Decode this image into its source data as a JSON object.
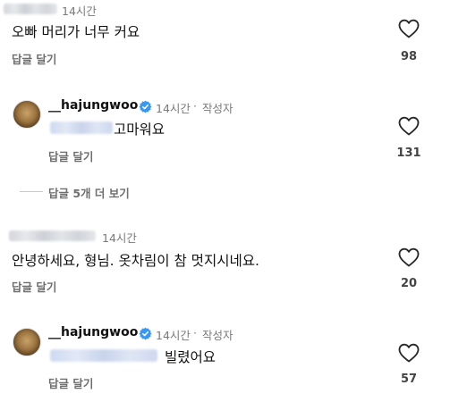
{
  "comments": [
    {
      "id": "c1",
      "time": "14시간",
      "text": "오빠 머리가 너무 커요",
      "reply_label": "답글 달기",
      "likes": "98"
    },
    {
      "id": "r1",
      "username": "__hajungwoo",
      "time": "14시간",
      "separator": "·",
      "author_tag": "작성자",
      "text": "고마워요",
      "reply_label": "답글 달기",
      "likes": "131"
    },
    {
      "id": "c2",
      "time": "14시간",
      "text": "안녕하세요, 형님. 옷차림이 참 멋지시네요.",
      "reply_label": "답글 달기",
      "likes": "20"
    },
    {
      "id": "r2",
      "username": "__hajungwoo",
      "time": "14시간",
      "separator": "·",
      "author_tag": "작성자",
      "text": "빌렸어요",
      "reply_label": "답글 달기",
      "likes": "57"
    }
  ],
  "view_more_replies": "답글 5개 더 보기",
  "icons": {
    "like": "heart-outline-icon",
    "verified": "verified-badge-icon"
  },
  "colors": {
    "verified_blue": "#3897f0",
    "meta_gray": "#7a7a7a"
  }
}
